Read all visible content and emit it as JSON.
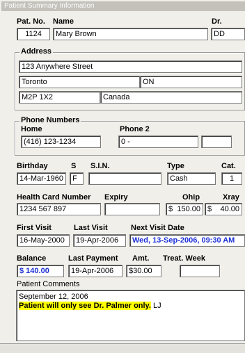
{
  "header": {
    "title": "Patient Summary Information"
  },
  "patient": {
    "pat_no_label": "Pat. No.",
    "name_label": "Name",
    "dr_label": "Dr.",
    "pat_no": "1124",
    "name": "Mary Brown",
    "dr": "DD"
  },
  "address": {
    "legend": "Address",
    "street": "123 Anywhere Street",
    "city": "Toronto",
    "province": "ON",
    "postal": "M2P 1X2",
    "country": "Canada"
  },
  "phones": {
    "legend": "Phone Numbers",
    "home_label": "Home",
    "phone2_label": "Phone 2",
    "home": "(416) 123-1234",
    "phone2": "0 -",
    "phone2_ext": ""
  },
  "personal": {
    "birthday_label": "Birthday",
    "s_label": "S",
    "sin_label": "S.I.N.",
    "type_label": "Type",
    "cat_label": "Cat.",
    "birthday": "14-Mar-1960",
    "s": "F",
    "sin": "",
    "type": "Cash",
    "cat": "1"
  },
  "health": {
    "hc_label": "Health Card Number",
    "expiry_label": "Expiry",
    "ohip_label": "Ohip",
    "xray_label": "Xray",
    "hc_number": "1234 567 897",
    "expiry": "",
    "ohip_prefix": "$",
    "ohip": "150.00",
    "xray_prefix": "$",
    "xray": "40.00"
  },
  "visits": {
    "first_label": "First Visit",
    "last_label": "Last Visit",
    "next_label": "Next Visit Date",
    "first": "16-May-2000",
    "last": "19-Apr-2006",
    "next": "Wed, 13-Sep-2006, 09:30 AM"
  },
  "billing": {
    "balance_label": "Balance",
    "last_payment_label": "Last Payment",
    "amt_label": "Amt.",
    "treat_week_label": "Treat. Week",
    "balance": "$ 140.00",
    "last_payment": "19-Apr-2006",
    "amt": "$30.00",
    "treat_week": ""
  },
  "comments": {
    "label": "Patient Comments",
    "line1": "September 12, 2006",
    "line2_highlight": "Patient will only see Dr. Palmer only.",
    "line2_suffix": " LJ"
  },
  "colors": {
    "accent": "#1c2fd6",
    "highlight": "#ffff00",
    "title_bar": "#c4c1bb"
  }
}
